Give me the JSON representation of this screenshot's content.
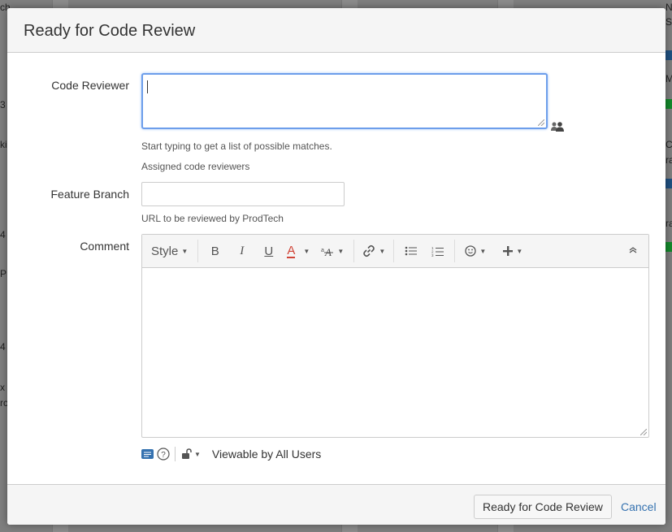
{
  "background": {
    "fragments": [
      "ch",
      "N",
      "Sl",
      "3",
      "Mi",
      "ki",
      "Ch",
      "ra",
      "4",
      "ra",
      "P",
      "4",
      "x",
      "rc"
    ]
  },
  "dialog": {
    "title": "Ready for Code Review",
    "code_reviewer": {
      "label": "Code Reviewer",
      "value": "",
      "hint": "Start typing to get a list of possible matches.",
      "hint2": "Assigned code reviewers"
    },
    "feature_branch": {
      "label": "Feature Branch",
      "value": "",
      "hint": "URL to be reviewed by ProdTech"
    },
    "comment": {
      "label": "Comment",
      "toolbar": {
        "style_label": "Style",
        "bold": "B",
        "italic": "I",
        "underline": "U",
        "text_color": "A"
      },
      "visibility": "Viewable by All Users"
    },
    "footer": {
      "submit_label": "Ready for Code Review",
      "cancel_label": "Cancel"
    }
  },
  "colors": {
    "accent_focus": "#6d9eeb",
    "link": "#3572b0",
    "text_color_underline": "#d04437",
    "tag_blue": "#205081",
    "tag_green": "#14892c"
  }
}
